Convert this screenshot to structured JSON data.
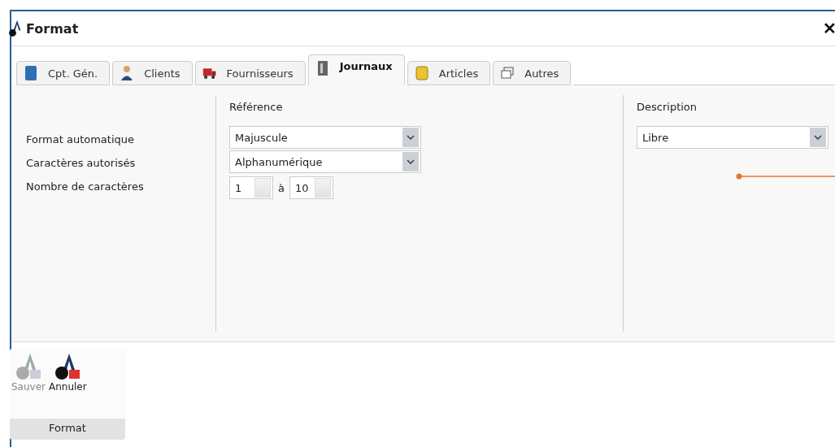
{
  "window": {
    "title": "Format",
    "close": "✕"
  },
  "tabs": [
    {
      "label": "Cpt. Gén.",
      "selected": false
    },
    {
      "label": "Clients",
      "selected": false
    },
    {
      "label": "Fournisseurs",
      "selected": false
    },
    {
      "label": "Journaux",
      "selected": true
    },
    {
      "label": "Articles",
      "selected": false
    },
    {
      "label": "Autres",
      "selected": false
    }
  ],
  "form": {
    "labels": [
      "Format automatique",
      "Caractères autorisés",
      "Nombre de caractères"
    ],
    "reference": {
      "heading": "Référence",
      "format": "Majuscule",
      "characters": "Alphanumérique",
      "min": "1",
      "separator": "à",
      "max": "10"
    },
    "description": {
      "heading": "Description",
      "format": "Libre"
    }
  },
  "toolbar": {
    "group": "Format",
    "buttons": [
      {
        "label": "Sauver",
        "disabled": true
      },
      {
        "label": "Annuler",
        "disabled": false
      }
    ]
  }
}
